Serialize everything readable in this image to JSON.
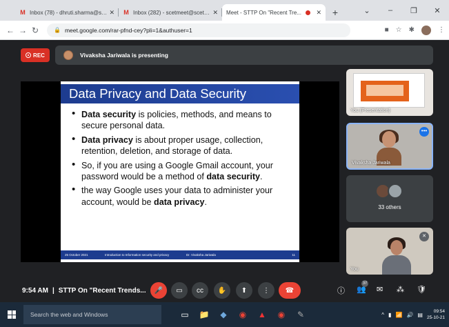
{
  "browser": {
    "tabs": [
      {
        "title": "Inbox (78) - dhruti.sharma@scet...",
        "icon": "gmail-icon",
        "active": false
      },
      {
        "title": "Inbox (282) - scetmeet@scet.ac...",
        "icon": "gmail-icon",
        "active": false
      },
      {
        "title": "Meet - STTP On \"Recent Tre...",
        "icon": "meet-icon",
        "active": true
      }
    ],
    "new_tab": "+",
    "url": "meet.google.com/rar-pfnd-cey?pli=1&authuser=1"
  },
  "meet": {
    "rec_label": "REC",
    "presenting_text": "Vivaksha Jariwala is presenting",
    "slide": {
      "title": "Data Privacy and Data Security",
      "bullets": [
        {
          "bold": "Data security",
          "text": " is policies, methods, and means to secure personal data."
        },
        {
          "bold": "Data privacy",
          "text": " is about proper usage, collection, retention, deletion, and storage of data."
        },
        {
          "pre": "So, if you are using a Google Gmail account, your password would be a method of ",
          "bold": "data security",
          "post": "."
        },
        {
          "pre": "the way Google uses your data to administer your account, would be ",
          "bold": "data privacy",
          "post": "."
        }
      ],
      "footer": {
        "date": "25 October 2021",
        "title": "Introduction to Information security and privacy",
        "author": "Dr. Vivaksha Jariwala",
        "page": "11"
      }
    },
    "tiles": {
      "presentation_label": "You (Presentation)",
      "presenter_name": "Vivaksha Jariwala",
      "others_label": "33 others",
      "self_label": "You"
    },
    "bottom": {
      "time": "9:54 AM",
      "separator": "|",
      "meeting_title": "STTP On \"Recent Trends...",
      "people_count": "37"
    }
  },
  "taskbar": {
    "search_placeholder": "Search the web and Windows",
    "time": "09:54",
    "date": "25-10-21"
  }
}
